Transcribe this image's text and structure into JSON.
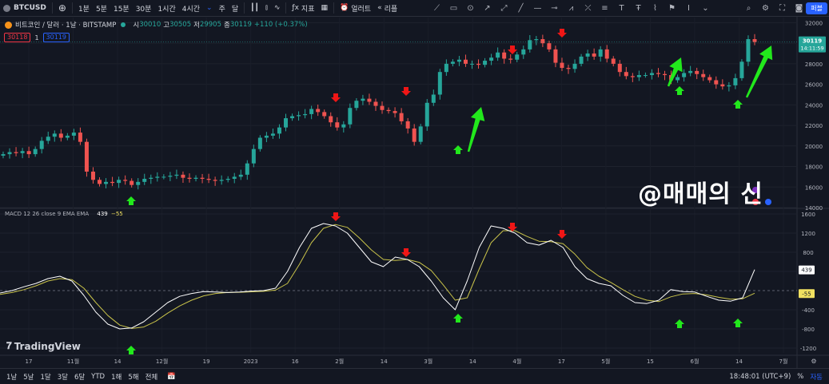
{
  "toolbar": {
    "symbol": "BTCUSD",
    "intervals": [
      "1분",
      "5분",
      "15분",
      "30분",
      "1시간",
      "4시간",
      "주",
      "달"
    ],
    "indicators_label": "지표",
    "alert_label": "얼러트",
    "replay_label": "리플",
    "publish_label": "퍼블"
  },
  "legend": {
    "title": "비트코인 / 달러 · 1날 · BITSTAMP",
    "open_label": "시",
    "open": "30010",
    "high_label": "고",
    "high": "30505",
    "low_label": "저",
    "low": "29905",
    "close_label": "종",
    "close": "30119",
    "change": "+110 (+0.37%)",
    "sell_price": "30118",
    "spread": "1",
    "buy_price": "30119"
  },
  "macd_legend": {
    "label": "MACD 12 26 close 9 EMA EMA",
    "macd_value": "439",
    "signal_value": "−55"
  },
  "price_axis": {
    "ticks": [
      "32000",
      "30000",
      "28000",
      "26000",
      "24000",
      "22000",
      "20000",
      "18000",
      "16000",
      "14000"
    ],
    "current_price": "30119",
    "countdown": "14:11:59"
  },
  "macd_axis": {
    "ticks": [
      "1600",
      "1200",
      "800",
      "400",
      "-400",
      "-800",
      "-1200"
    ],
    "macd_tag": "439",
    "signal_tag": "-55"
  },
  "time_axis": {
    "ticks": [
      "17",
      "11월",
      "14",
      "12월",
      "19",
      "2023",
      "16",
      "2월",
      "14",
      "3월",
      "14",
      "4월",
      "17",
      "5월",
      "15",
      "6월",
      "14",
      "7월"
    ]
  },
  "watermark": "@매매의 신",
  "brand": "TradingView",
  "bottombar": {
    "ranges": [
      "1날",
      "5날",
      "1달",
      "3달",
      "6달",
      "YTD",
      "1해",
      "5해",
      "전체"
    ],
    "clock": "18:48:01 (UTC+9)",
    "percent": "%",
    "auto": "자동"
  },
  "colors": {
    "background": "#131722",
    "up": "#26a69a",
    "down": "#ef5350",
    "arrow_up": "#22e81c",
    "arrow_down": "#f01616",
    "macd_line": "#ffffff",
    "signal_line": "#c9c34a",
    "accent": "#2962ff"
  },
  "chart_data": [
    {
      "type": "candlestick",
      "title": "비트코인 / 달러 · 1날 · BITSTAMP",
      "ylim": [
        14000,
        32500
      ],
      "x_labels": [
        "17",
        "11월",
        "14",
        "12월",
        "19",
        "2023",
        "16",
        "2월",
        "14",
        "3월",
        "14",
        "4월",
        "17",
        "5월",
        "15",
        "6월",
        "14",
        "7월"
      ],
      "series": [
        {
          "name": "BTCUSD",
          "approx_close": [
            19200,
            19400,
            19300,
            19500,
            19200,
            19700,
            20500,
            20900,
            21200,
            20800,
            21000,
            21300,
            20400,
            17500,
            16700,
            16300,
            16500,
            16400,
            16700,
            16600,
            16200,
            16500,
            16800,
            16900,
            17000,
            17000,
            17100,
            17200,
            16900,
            16800,
            16900,
            16800,
            16700,
            16600,
            16700,
            16800,
            17000,
            17200,
            18300,
            19700,
            20800,
            21000,
            21200,
            21800,
            22700,
            22900,
            23000,
            23100,
            23600,
            23300,
            22900,
            22300,
            21800,
            22100,
            23700,
            24400,
            24600,
            24300,
            23900,
            23500,
            23400,
            23200,
            22400,
            21700,
            20400,
            21900,
            24200,
            25000,
            27200,
            28000,
            28200,
            28400,
            28000,
            28000,
            27900,
            28300,
            28600,
            29100,
            28500,
            28400,
            28900,
            29400,
            30300,
            30400,
            30000,
            29400,
            28100,
            27600,
            27500,
            28000,
            28700,
            29000,
            28700,
            29400,
            28500,
            28000,
            27200,
            26800,
            26700,
            26900,
            26900,
            27100,
            27000,
            26900,
            26400,
            26700,
            27100,
            27300,
            27000,
            26700,
            26400,
            26000,
            25800,
            25900,
            26600,
            28200,
            30400,
            30119
          ]
        }
      ]
    },
    {
      "type": "line",
      "title": "MACD 12 26 close 9 EMA EMA",
      "ylim": [
        -1300,
        1700
      ],
      "series": [
        {
          "name": "MACD",
          "values": [
            -50,
            0,
            80,
            150,
            250,
            300,
            200,
            -100,
            -450,
            -700,
            -800,
            -780,
            -650,
            -450,
            -250,
            -120,
            -60,
            -20,
            -30,
            -40,
            -30,
            -10,
            0,
            50,
            400,
            900,
            1300,
            1400,
            1350,
            1200,
            900,
            600,
            500,
            700,
            650,
            500,
            200,
            -150,
            -400,
            200,
            900,
            1350,
            1300,
            1200,
            1000,
            950,
            1050,
            900,
            500,
            250,
            150,
            100,
            -100,
            -250,
            -270,
            -200,
            20,
            -20,
            -30,
            -120,
            -200,
            -220,
            -150,
            439
          ]
        },
        {
          "name": "Signal",
          "values": [
            -80,
            -40,
            20,
            100,
            200,
            250,
            230,
            50,
            -250,
            -520,
            -720,
            -790,
            -760,
            -640,
            -470,
            -320,
            -200,
            -110,
            -60,
            -40,
            -35,
            -25,
            -15,
            10,
            150,
            550,
            1000,
            1300,
            1380,
            1320,
            1100,
            850,
            650,
            630,
            650,
            590,
            420,
            120,
            -200,
            -150,
            450,
            1000,
            1250,
            1250,
            1130,
            1030,
            1020,
            980,
            760,
            480,
            300,
            170,
            20,
            -120,
            -200,
            -230,
            -130,
            -70,
            -60,
            -90,
            -140,
            -180,
            -170,
            -55
          ]
        }
      ]
    }
  ]
}
